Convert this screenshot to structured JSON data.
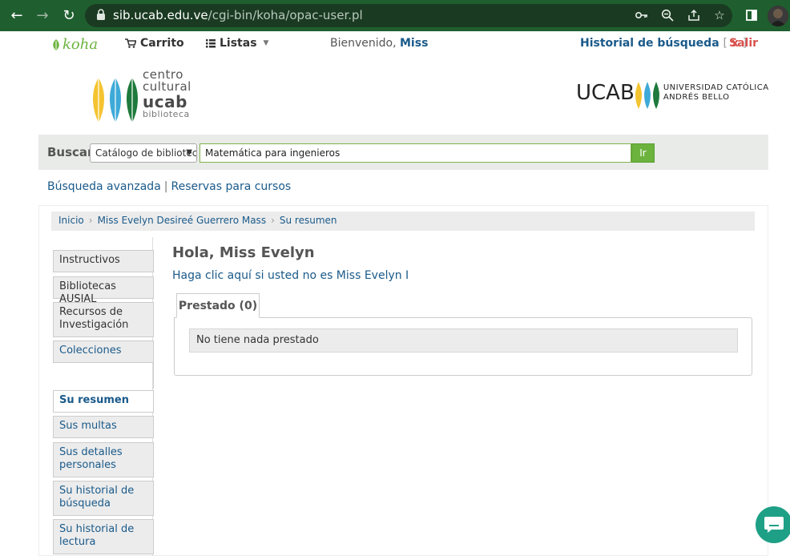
{
  "browser": {
    "url_host": "sib.ucab.edu.ve",
    "url_path": "/cgi-bin/koha/opac-user.pl"
  },
  "topnav": {
    "logo": "koha",
    "cart": "Carrito",
    "lists": "Listas",
    "welcome_prefix": "Bienvenido,",
    "welcome_user": "Miss",
    "history": "Historial de búsqueda",
    "history_bracket_open": "[",
    "history_x": "x",
    "history_bracket_close": "]",
    "logout": "Salir"
  },
  "header": {
    "cc_line1": "centro",
    "cc_line2": "cultural",
    "cc_line3": "ucab",
    "cc_line4": "biblioteca",
    "ucab_word": "UCAB",
    "ucab_line1": "UNIVERSIDAD CATÓLICA",
    "ucab_line2": "ANDRÉS BELLO"
  },
  "search": {
    "label": "Buscar",
    "catalog_selected": "Catálogo de bibliotec",
    "query": "Matemática para ingenieros",
    "go": "Ir"
  },
  "links": {
    "advanced": "Búsqueda avanzada",
    "separator": "|",
    "course_reserves": "Reservas para cursos"
  },
  "breadcrumb": {
    "home": "Inicio",
    "sep": "›",
    "user": "Miss Evelyn Desireé Guerrero Mass",
    "summary": "Su resumen"
  },
  "sidebar": {
    "top_items": [
      {
        "label": "Instructivos"
      },
      {
        "label": "Bibliotecas AUSJAL"
      },
      {
        "label": "Recursos de Investigación"
      },
      {
        "label": "Colecciones"
      }
    ],
    "user_items": [
      {
        "label": "Su resumen"
      },
      {
        "label": "Sus multas"
      },
      {
        "label": "Sus detalles personales"
      },
      {
        "label": "Su historial de búsqueda"
      },
      {
        "label": "Su historial de lectura"
      }
    ]
  },
  "main": {
    "greeting": "Hola, Miss Evelyn",
    "not_you": "Haga clic aquí si usted no es Miss Evelyn I",
    "tab_checked_out": "Prestado (0)",
    "empty_message": "No tiene nada prestado"
  },
  "colors": {
    "chrome": "#1f5f2f",
    "koha_green": "#6cb33e",
    "link": "#1a5a8a",
    "logout": "#d9534f",
    "chat": "#1ea086"
  }
}
